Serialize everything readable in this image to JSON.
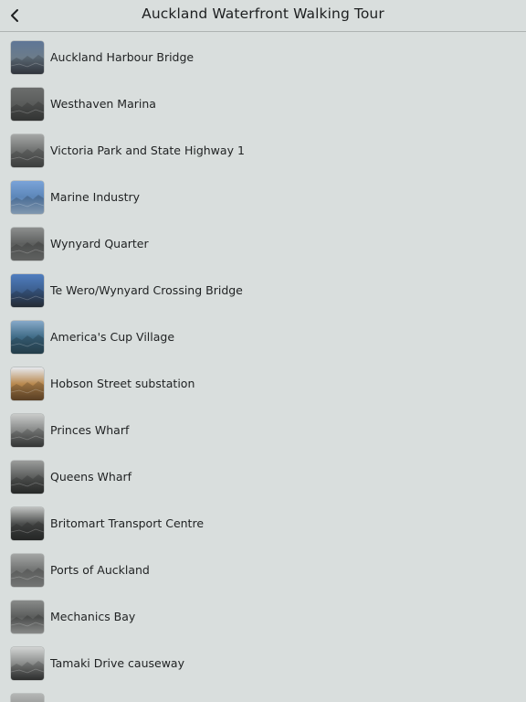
{
  "header": {
    "title": "Auckland Waterfront Walking Tour",
    "back_icon": "chevron-left-icon"
  },
  "items": [
    {
      "label": "Auckland Harbour Bridge",
      "thumb": {
        "top": "#5f7696",
        "mid": "#6c7c8a",
        "bottom": "#3b4049",
        "style": "color"
      }
    },
    {
      "label": "Westhaven Marina",
      "thumb": {
        "top": "#6b6d6c",
        "mid": "#5a5c5b",
        "bottom": "#3e403f",
        "style": "mono"
      }
    },
    {
      "label": "Victoria Park and State Highway 1",
      "thumb": {
        "top": "#a4a6a5",
        "mid": "#6e706f",
        "bottom": "#4a4c4b",
        "style": "mono"
      }
    },
    {
      "label": "Marine Industry",
      "thumb": {
        "top": "#7aa3d8",
        "mid": "#5c86b8",
        "bottom": "#9db9d6",
        "style": "color"
      }
    },
    {
      "label": "Wynyard Quarter",
      "thumb": {
        "top": "#8d8f8e",
        "mid": "#5d5f5e",
        "bottom": "#767877",
        "style": "mono"
      }
    },
    {
      "label": "Te Wero/Wynyard Crossing Bridge",
      "thumb": {
        "top": "#4f7dbf",
        "mid": "#3d5f8f",
        "bottom": "#2e3540",
        "style": "color"
      }
    },
    {
      "label": "America's Cup Village",
      "thumb": {
        "top": "#87a9c9",
        "mid": "#3f6b86",
        "bottom": "#2c4b5a",
        "style": "color"
      }
    },
    {
      "label": "Hobson Street substation",
      "thumb": {
        "top": "#e6e9ee",
        "mid": "#b9894f",
        "bottom": "#6d4d2c",
        "style": "color"
      }
    },
    {
      "label": "Princes Wharf",
      "thumb": {
        "top": "#c9cbca",
        "mid": "#868887",
        "bottom": "#3f4140",
        "style": "mono"
      }
    },
    {
      "label": "Queens Wharf",
      "thumb": {
        "top": "#9a9c9b",
        "mid": "#5c5e5d",
        "bottom": "#2f3130",
        "style": "mono"
      }
    },
    {
      "label": "Britomart Transport Centre",
      "thumb": {
        "top": "#bfc1c0",
        "mid": "#4b4d4c",
        "bottom": "#2d2f2e",
        "style": "mono"
      }
    },
    {
      "label": "Ports of Auckland",
      "thumb": {
        "top": "#a3a5a4",
        "mid": "#707271",
        "bottom": "#8d8f8e",
        "style": "mono"
      }
    },
    {
      "label": "Mechanics Bay",
      "thumb": {
        "top": "#888a89",
        "mid": "#5b5d5c",
        "bottom": "#a6a8a7",
        "style": "mono"
      }
    },
    {
      "label": "Tamaki Drive causeway",
      "thumb": {
        "top": "#d2d4d3",
        "mid": "#8a8c8b",
        "bottom": "#363837",
        "style": "mono"
      }
    },
    {
      "label": "",
      "thumb": {
        "top": "#b4b6b5",
        "mid": "#8d8f8e",
        "bottom": "#6a6c6b",
        "style": "mono"
      }
    }
  ]
}
